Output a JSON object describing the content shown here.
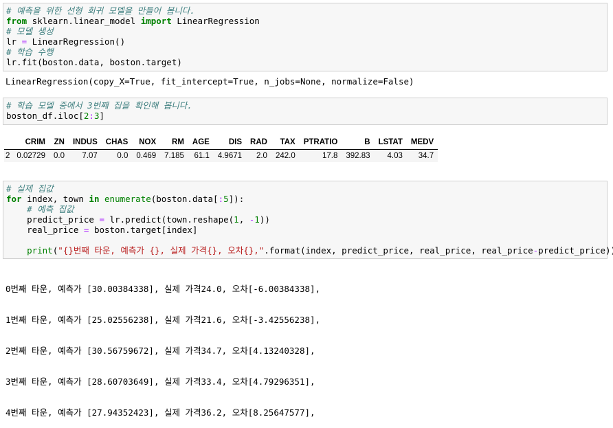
{
  "cell1": {
    "comment1": "# 예측을 위한 선형 회귀 모델을 만들어 봅니다.",
    "l2_kw_from": "from",
    "l2_module": " sklearn.linear_model ",
    "l2_kw_import": "import",
    "l2_class": " LinearRegression",
    "comment2": "# 모델 생성",
    "l4_var": "lr ",
    "l4_eq": "=",
    "l4_rest": " LinearRegression()",
    "comment3": "# 학습 수행",
    "l6": "lr.fit(boston.data, boston.target)"
  },
  "output1": "LinearRegression(copy_X=True, fit_intercept=True, n_jobs=None, normalize=False)",
  "cell2": {
    "comment": "# 학습 모델 중에서 3번째 집을 확인해 봅니다.",
    "code_prefix": "boston_df.iloc[",
    "code_num1": "2",
    "code_colon": ":",
    "code_num2": "3",
    "code_suffix": "]"
  },
  "dataframe": {
    "columns": [
      "",
      "CRIM",
      "ZN",
      "INDUS",
      "CHAS",
      "NOX",
      "RM",
      "AGE",
      "DIS",
      "RAD",
      "TAX",
      "PTRATIO",
      "B",
      "LSTAT",
      "MEDV"
    ],
    "row": [
      "2",
      "0.02729",
      "0.0",
      "7.07",
      "0.0",
      "0.469",
      "7.185",
      "61.1",
      "4.9671",
      "2.0",
      "242.0",
      "17.8",
      "392.83",
      "4.03",
      "34.7"
    ]
  },
  "cell3": {
    "comment1": "# 실제 집값",
    "l2_kw_for": "for",
    "l2_mid": " index, town ",
    "l2_kw_in": "in",
    "l2_sp": " ",
    "l2_enumerate": "enumerate",
    "l2_a": "(boston.data[",
    "l2_colon": ":",
    "l2_num": "5",
    "l2_b": "]):",
    "comment2": "    # 예측 집값",
    "l4_a": "    predict_price ",
    "l4_eq": "=",
    "l4_b": " lr.predict(town.reshape(",
    "l4_n1": "1",
    "l4_c": ", ",
    "l4_minus": "-",
    "l4_n2": "1",
    "l4_d": "))",
    "l5_a": "    real_price ",
    "l5_eq": "=",
    "l5_b": " boston.target[index]",
    "l7_indent": "    ",
    "l7_print": "print",
    "l7_open": "(",
    "l7_str": "\"{}번째 타운, 예측가 {}, 실제 가격{}, 오차{},\"",
    "l7_a": ".format(index, predict_price, real_price, real_price",
    "l7_minus": "-",
    "l7_b": "predict_price))"
  },
  "output3": [
    "0번째 타운, 예측가 [30.00384338], 실제 가격24.0, 오차[-6.00384338],",
    "1번째 타운, 예측가 [25.02556238], 실제 가격21.6, 오차[-3.42556238],",
    "2번째 타운, 예측가 [30.56759672], 실제 가격34.7, 오차[4.13240328],",
    "3번째 타운, 예측가 [28.60703649], 실제 가격33.4, 오차[4.79296351],",
    "4번째 타운, 예측가 [27.94352423], 실제 가격36.2, 오차[8.25647577],"
  ]
}
